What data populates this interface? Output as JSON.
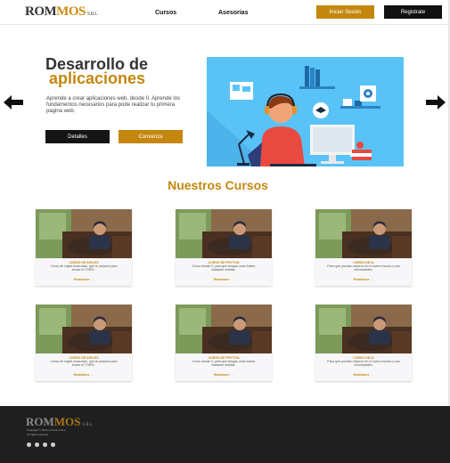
{
  "header": {
    "logo_main": "ROM",
    "logo_accent": "MOS",
    "logo_suffix": "S.R.L",
    "nav": [
      "Cursos",
      "Asesorias"
    ],
    "login_label": "Iniciar Sesión",
    "register_label": "Registrate"
  },
  "hero": {
    "title_line1": "Desarrollo de",
    "title_line2": "aplicaciones",
    "description": "Aprende a crear aplicaciones web, desde 0. Aprende los fundamentos necesarios para pode realizar tu primera pagina web.",
    "details_label": "Detalles",
    "start_label": "Comienza"
  },
  "courses": {
    "section_title": "Nuestros Cursos",
    "items": [
      {
        "title": "CURSO DE INGLES",
        "desc": "Curso de ingles avanzado, que te prepara para tomar el TOEFL.",
        "link": "Readmore →"
      },
      {
        "title": "CURSO DE PHYTON",
        "desc": "Curso desde 0, para que tengas unas bases bastante sólidas.",
        "link": "Readmore →"
      },
      {
        "title": "CURSO DE IA",
        "desc": "Para que puedas mejorar en el nuevo mundo y sus necesidades.",
        "link": "Readmore →"
      },
      {
        "title": "CURSO DE INGLES",
        "desc": "Curso de ingles avanzado, que te prepara para tomar el TOEFL.",
        "link": "Readmore →"
      },
      {
        "title": "CURSO DE PHYTON",
        "desc": "Curso desde 0, para que tengas unas bases bastante sólidas.",
        "link": "Readmore →"
      },
      {
        "title": "CURSO DE IA",
        "desc": "Para que puedas mejorar en el nuevo mundo y sus necesidades.",
        "link": "Readmore →"
      }
    ]
  },
  "footer": {
    "logo_main": "ROM",
    "logo_accent": "MOS",
    "logo_suffix": "S.R.L",
    "line1": "Copyright © 2023 rommos S.R.L",
    "line2": "All rights reserved",
    "social_icons": [
      "instagram-icon",
      "dribbble-icon",
      "twitter-icon",
      "youtube-icon"
    ]
  },
  "colors": {
    "accent": "#c4870e",
    "dark": "#151515",
    "footer_bg": "#1f1f1f",
    "hero_bg": "#59c3f7"
  }
}
